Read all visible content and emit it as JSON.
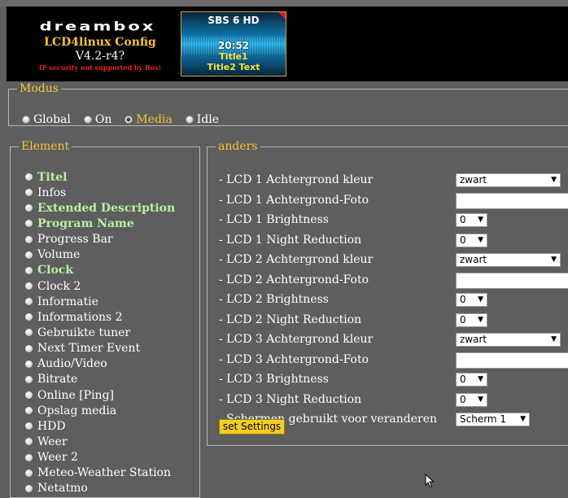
{
  "header": {
    "logo_word": "dreambox",
    "title": "LCD4linux Config",
    "version": "V4.2-r4?",
    "warning": "IP security not supported by Box!"
  },
  "lcd_preview": {
    "channel": "SBS 6 HD",
    "time": "20:52",
    "title1": "Title1",
    "title2": "Title2 Text"
  },
  "modus": {
    "legend": "Modus",
    "options": [
      {
        "label": "Global",
        "checked": false
      },
      {
        "label": "On",
        "checked": false
      },
      {
        "label": "Media",
        "checked": true
      },
      {
        "label": "Idle",
        "checked": false
      }
    ]
  },
  "element": {
    "legend": "Element",
    "items": [
      {
        "label": "Titel",
        "highlight": true
      },
      {
        "label": "Infos",
        "highlight": false
      },
      {
        "label": "Extended Description",
        "highlight": true
      },
      {
        "label": "Program Name",
        "highlight": true
      },
      {
        "label": "Progress Bar",
        "highlight": false
      },
      {
        "label": "Volume",
        "highlight": false
      },
      {
        "label": "Clock",
        "highlight": true
      },
      {
        "label": "Clock 2",
        "highlight": false
      },
      {
        "label": "Informatie",
        "highlight": false
      },
      {
        "label": "Informations 2",
        "highlight": false
      },
      {
        "label": "Gebruikte tuner",
        "highlight": false
      },
      {
        "label": "Next Timer Event",
        "highlight": false
      },
      {
        "label": "Audio/Video",
        "highlight": false
      },
      {
        "label": "Bitrate",
        "highlight": false
      },
      {
        "label": "Online [Ping]",
        "highlight": false
      },
      {
        "label": "Opslag media",
        "highlight": false
      },
      {
        "label": "HDD",
        "highlight": false
      },
      {
        "label": "Weer",
        "highlight": false
      },
      {
        "label": "Weer 2",
        "highlight": false
      },
      {
        "label": "Meteo-Weather Station",
        "highlight": false
      },
      {
        "label": "Netatmo",
        "highlight": false
      }
    ]
  },
  "anders": {
    "legend": "anders",
    "rows": [
      {
        "label": "- LCD 1 Achtergrond kleur",
        "kind": "select-wide",
        "value": "zwart"
      },
      {
        "label": "- LCD 1 Achtergrond-Foto",
        "kind": "text",
        "value": ""
      },
      {
        "label": "- LCD 1 Brightness",
        "kind": "select-narrow",
        "value": "0"
      },
      {
        "label": "- LCD 1 Night Reduction",
        "kind": "select-narrow",
        "value": "0"
      },
      {
        "label": "- LCD 2 Achtergrond kleur",
        "kind": "select-wide",
        "value": "zwart"
      },
      {
        "label": "- LCD 2 Achtergrond-Foto",
        "kind": "text",
        "value": ""
      },
      {
        "label": "- LCD 2 Brightness",
        "kind": "select-narrow",
        "value": "0"
      },
      {
        "label": "- LCD 2 Night Reduction",
        "kind": "select-narrow",
        "value": "0"
      },
      {
        "label": "- LCD 3 Achtergrond kleur",
        "kind": "select-wide",
        "value": "zwart"
      },
      {
        "label": "- LCD 3 Achtergrond-Foto",
        "kind": "text",
        "value": ""
      },
      {
        "label": "- LCD 3 Brightness",
        "kind": "select-narrow",
        "value": "0"
      },
      {
        "label": "- LCD 3 Night Reduction",
        "kind": "select-narrow",
        "value": "0"
      },
      {
        "label": "- Schermen gebruikt voor veranderen",
        "kind": "select-mid",
        "value": "Scherm 1"
      }
    ],
    "button": "set Settings"
  },
  "colors": {
    "accent": "#f5c431",
    "highlight_text": "#b7f2a0",
    "background": "#5e5e5e",
    "button": "#f7cd21"
  }
}
